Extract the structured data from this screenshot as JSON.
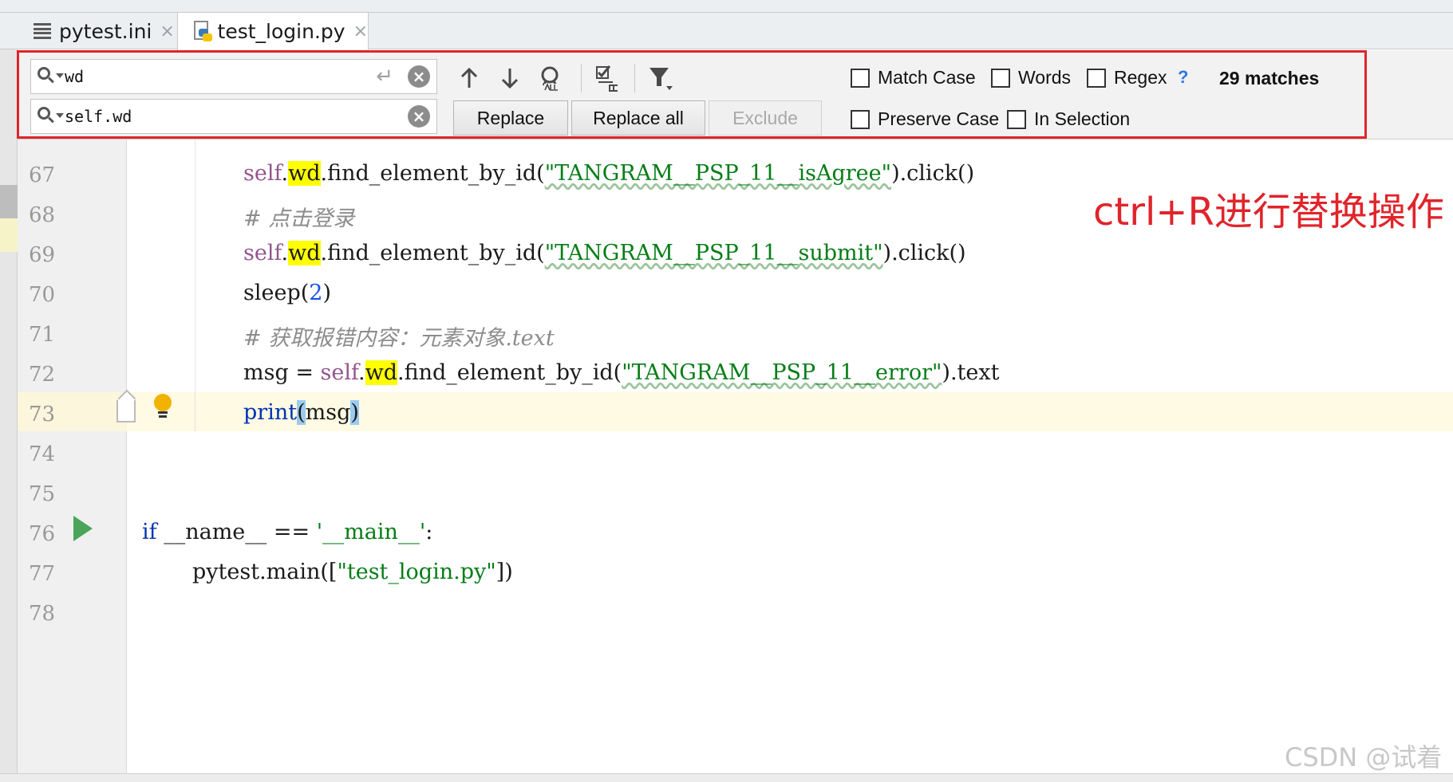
{
  "tabs": [
    {
      "label": "pytest.ini",
      "close": "×"
    },
    {
      "label": "test_login.py",
      "close": "×"
    }
  ],
  "find": {
    "search_value": "wd",
    "replace_value": "self.wd",
    "enter_glyph": "↵",
    "clear_glyph": "×",
    "replace_label": "Replace",
    "replace_all_label": "Replace all",
    "exclude_label": "Exclude",
    "options": {
      "match_case": "Match Case",
      "words": "Words",
      "regex": "Regex",
      "preserve_case": "Preserve Case",
      "in_selection": "In Selection"
    },
    "help": "?",
    "matches": "29 matches",
    "icons": [
      "arrow-up-icon",
      "arrow-down-icon",
      "select-all-occurrences-icon",
      "filter-checklist-icon",
      "filter-icon"
    ]
  },
  "gutter": {
    "line_numbers": [
      "67",
      "68",
      "69",
      "70",
      "71",
      "72",
      "73",
      "74",
      "75",
      "76",
      "77",
      "78"
    ]
  },
  "code": {
    "l67": {
      "self": "self",
      "dot": ".",
      "wd": "wd",
      "call": ".find_element_by_id(",
      "str": "\"TANGRAM__PSP_11__isAgree\"",
      "end": ").click()"
    },
    "l68": {
      "comment": "# 点击登录"
    },
    "l69": {
      "self": "self",
      "dot": ".",
      "wd": "wd",
      "call": ".find_element_by_id(",
      "str": "\"TANGRAM__PSP_11__submit\"",
      "end": ").click()"
    },
    "l70": {
      "fn": "sleep(",
      "num": "2",
      "end": ")"
    },
    "l71": {
      "comment": "# 获取报错内容：元素对象.text"
    },
    "l72": {
      "lhs": "msg = ",
      "self": "self",
      "dot": ".",
      "wd": "wd",
      "call": ".find_element_by_id(",
      "str": "\"TANGRAM__PSP_11__error\"",
      "end": ").text"
    },
    "l73": {
      "fn": "print",
      "open": "(",
      "arg": "msg",
      "close": ")"
    },
    "l76": {
      "kw": "if",
      "mid": " __name__ == ",
      "str": "'__main__'",
      "end": ":"
    },
    "l77": {
      "call": "pytest.main([",
      "str": "\"test_login.py\"",
      "end": "])"
    }
  },
  "annotation": "ctrl+R进行替换操作",
  "watermark": "CSDN @试着",
  "colors": {
    "highlight": "#ffff00",
    "annotation_red": "#e0242b",
    "string_green": "#067d17",
    "keyword_blue": "#0033b3",
    "self_purple": "#94558d"
  }
}
